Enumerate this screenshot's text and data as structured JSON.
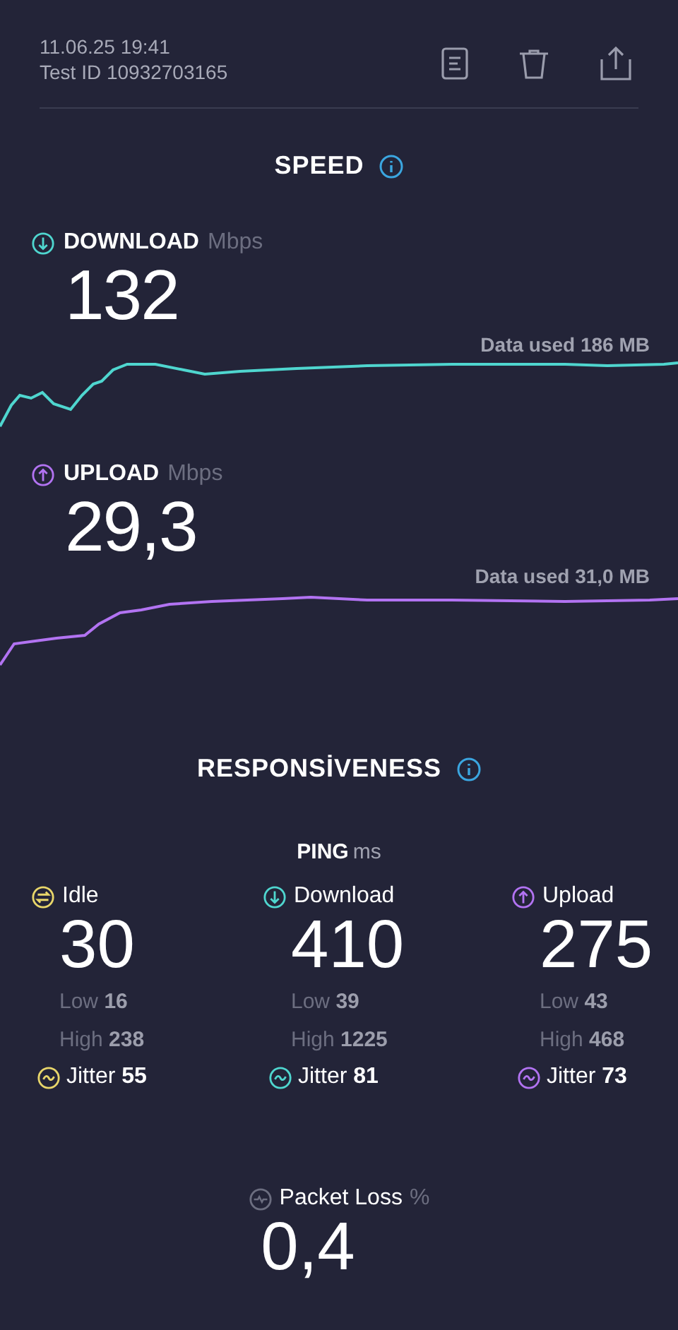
{
  "header": {
    "date": "11.06.25 19:41",
    "test_id": "Test ID 10932703165"
  },
  "speed": {
    "title": "SPEED",
    "measures": [
      {
        "kind": "download",
        "label": "DOWNLOAD",
        "unit": "Mbps",
        "value": "132",
        "data_used": "Data used 186 MB",
        "color": "#4fd6cf"
      },
      {
        "kind": "upload",
        "label": "UPLOAD",
        "unit": "Mbps",
        "value": "29,3",
        "data_used": "Data used 31,0 MB",
        "color": "#b273f2"
      }
    ]
  },
  "responsiveness": {
    "title": "RESPONSİVENESS",
    "ping_title": "PING",
    "ping_unit": "ms",
    "columns": [
      {
        "kind": "idle",
        "label": "Idle",
        "value": "30",
        "low_label": "Low",
        "low": "16",
        "high_label": "High",
        "high": "238",
        "jitter_label": "Jitter",
        "jitter": "55",
        "color": "#e8d66a"
      },
      {
        "kind": "download",
        "label": "Download",
        "value": "410",
        "low_label": "Low",
        "low": "39",
        "high_label": "High",
        "high": "1225",
        "jitter_label": "Jitter",
        "jitter": "81",
        "color": "#4fd6cf"
      },
      {
        "kind": "upload",
        "label": "Upload",
        "value": "275",
        "low_label": "Low",
        "low": "43",
        "high_label": "High",
        "high": "468",
        "jitter_label": "Jitter",
        "jitter": "73",
        "color": "#b273f2"
      }
    ]
  },
  "packet_loss": {
    "label": "Packet Loss",
    "unit": "%",
    "value": "0,4"
  }
}
